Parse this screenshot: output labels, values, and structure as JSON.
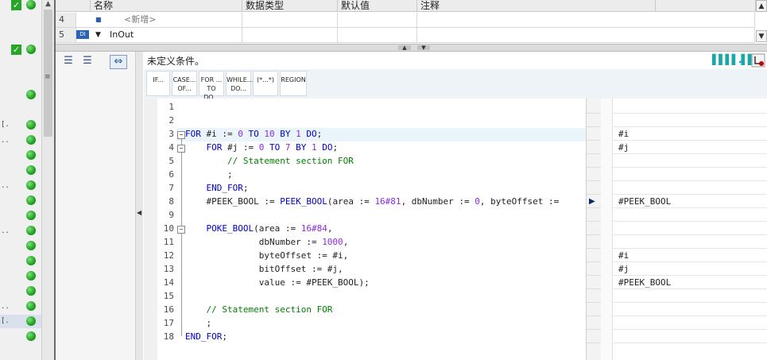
{
  "table": {
    "headers": {
      "name": "名称",
      "datatype": "数据类型",
      "default": "默认值",
      "comment": "注释"
    },
    "rows": [
      {
        "num": "4",
        "name": "<新增>",
        "datatype": "",
        "default": "",
        "comment": ""
      },
      {
        "num": "5",
        "tag": "DI",
        "name": "InOut",
        "datatype": "",
        "default": "",
        "comment": ""
      }
    ]
  },
  "editor": {
    "condition_text": "未定义条件。",
    "status_bars": "▌▌▌▌.▌▌",
    "keyword_buttons": [
      {
        "l1": "IF...",
        "l2": ""
      },
      {
        "l1": "CASE...",
        "l2": "OF..."
      },
      {
        "l1": "FOR ...",
        "l2": "TO DO..."
      },
      {
        "l1": "WHILE...",
        "l2": "DO..."
      },
      {
        "l1": "(*...*)",
        "l2": ""
      },
      {
        "l1": "REGION",
        "l2": ""
      }
    ],
    "line_numbers": [
      "1",
      "2",
      "3",
      "4",
      "5",
      "6",
      "7",
      "8",
      "9",
      "10",
      "11",
      "12",
      "13",
      "14",
      "15",
      "16",
      "17",
      "18"
    ],
    "watch_values": [
      "",
      "",
      "#i",
      "#j",
      "",
      "",
      "",
      "#PEEK_BOOL",
      "",
      "",
      "",
      "#i",
      "#j",
      "#PEEK_BOOL",
      "",
      "",
      "",
      ""
    ]
  },
  "colors": {
    "accent": "#1ea11e",
    "keyword": "#0000cc",
    "comment": "#008000"
  }
}
